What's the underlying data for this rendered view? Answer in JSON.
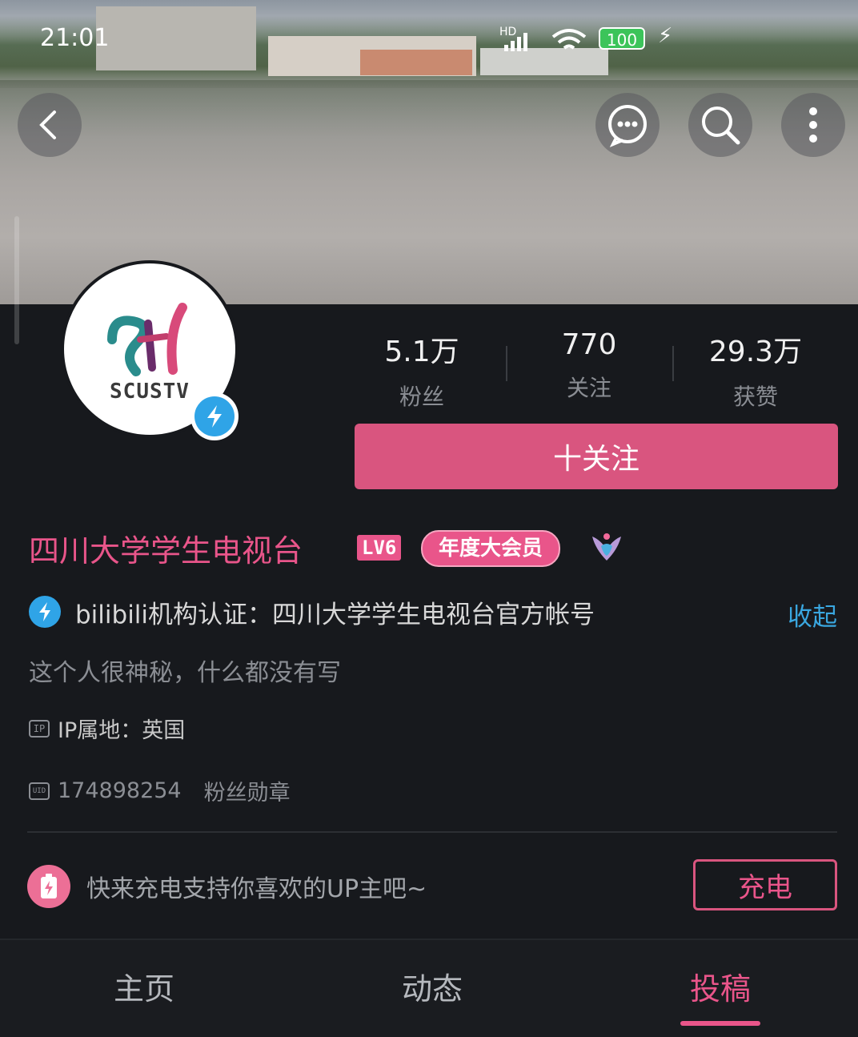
{
  "status_bar": {
    "time": "21:01",
    "network": "HD",
    "battery": "100"
  },
  "nav": {
    "back": "back",
    "message": "message",
    "search": "search",
    "more": "more"
  },
  "avatar": {
    "logo_text": "SCUSTV"
  },
  "stats": [
    {
      "value": "5.1万",
      "label": "粉丝"
    },
    {
      "value": "770",
      "label": "关注"
    },
    {
      "value": "29.3万",
      "label": "获赞"
    }
  ],
  "follow_label": "十关注",
  "profile": {
    "name": "四川大学学生电视台",
    "level": "LV6",
    "vip": "年度大会员",
    "certification": "bilibili机构认证：四川大学学生电视台官方帐号",
    "collapse_label": "收起",
    "bio": "这个人很神秘，什么都没有写",
    "ip_badge": "IP",
    "ip_location": "IP属地：英国",
    "uid_badge": "UID",
    "uid": "174898254",
    "fan_medal": "粉丝勋章"
  },
  "charge": {
    "prompt": "快来充电支持你喜欢的UP主吧~",
    "button": "充电"
  },
  "tabs": [
    {
      "label": "主页"
    },
    {
      "label": "动态"
    },
    {
      "label": "投稿"
    }
  ],
  "colors": {
    "accent": "#e9558a",
    "link": "#3aa7e0",
    "verify": "#2fa4e7",
    "background": "#17191d"
  }
}
